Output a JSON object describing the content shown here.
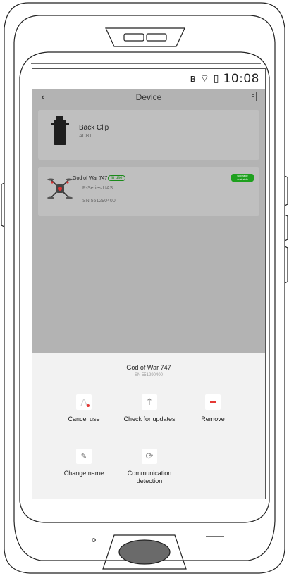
{
  "status_bar": {
    "time": "10:08",
    "icons": [
      "bluetooth-icon",
      "wifi-icon",
      "battery-icon"
    ]
  },
  "nav": {
    "title": "Device",
    "back_icon": "chevron-left-icon",
    "right_icon": "document-icon"
  },
  "devices": [
    {
      "name": "Back Clip",
      "model": "ACB1",
      "image_icon": "back-clip-icon"
    },
    {
      "name": "God of War 747",
      "status_badge": "In use",
      "series": "P-Series UAS",
      "sn": "SN 551290400",
      "upgrade_badge": "Upgrade available",
      "image_icon": "drone-icon"
    }
  ],
  "sheet": {
    "title": "God of War 747",
    "sn": "SN 551290400",
    "actions": [
      {
        "label": "Cancel use",
        "icon": "cancel-use-icon"
      },
      {
        "label": "Check for updates",
        "icon": "arrow-up-icon"
      },
      {
        "label": "Remove",
        "icon": "minus-icon"
      },
      {
        "label": "Change name",
        "icon": "pencil-icon"
      },
      {
        "label": "Communication detection",
        "icon": "sync-icon"
      }
    ]
  },
  "colors": {
    "in_use_green": "#1a8a1a",
    "upgrade_green": "#1ea01e",
    "danger_red": "#e53935",
    "overlay_gray": "#b3b3b3",
    "sheet_bg": "#f2f2f2"
  }
}
